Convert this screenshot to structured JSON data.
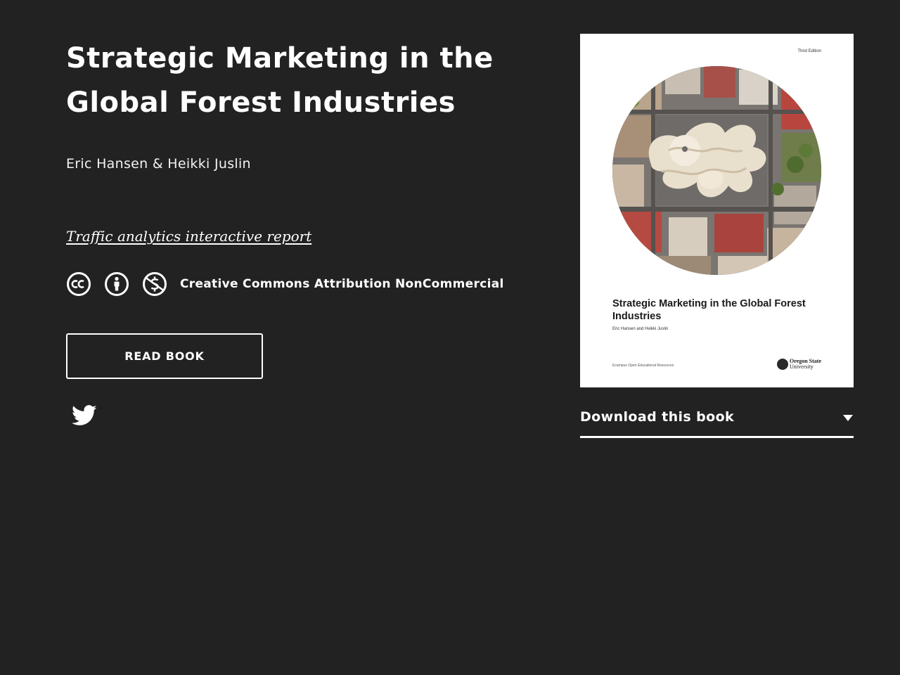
{
  "book": {
    "title": "Strategic Marketing in the Global Forest Industries",
    "authors": "Eric Hansen & Heikki Juslin"
  },
  "links": {
    "analytics": "Traffic analytics interactive report"
  },
  "license": {
    "text": "Creative Commons Attribution NonCommercial",
    "icons": [
      "cc-icon",
      "by-attribution-icon",
      "noncommercial-icon"
    ]
  },
  "actions": {
    "read_label": "READ BOOK"
  },
  "share": {
    "icons": [
      "twitter-icon"
    ]
  },
  "cover": {
    "edition": "Third Edition",
    "title": "Strategic Marketing in the Global Forest Industries",
    "authors": "Eric Hansen and Heikki Juslin",
    "publisher": "Ecampus Open Educational Resources",
    "logo_line1": "Oregon State",
    "logo_line2": "University"
  },
  "download": {
    "label": "Download this book"
  },
  "colors": {
    "background": "#222222",
    "text": "#ffffff"
  }
}
